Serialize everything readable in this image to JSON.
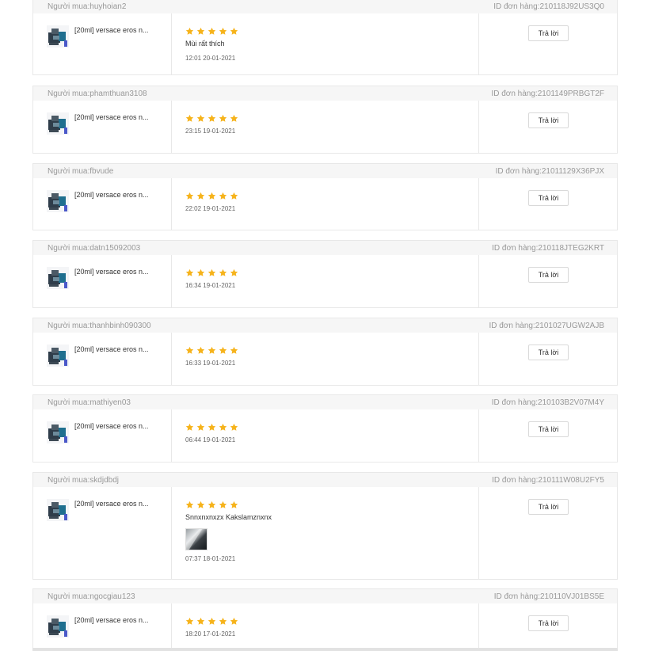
{
  "labels": {
    "buyer_prefix": "Người mua:",
    "order_prefix": "ID đơn hàng:",
    "reply_button": "Trả lời"
  },
  "colors": {
    "star": "#f6b31b",
    "border": "#e8e8e8",
    "header_bg": "#f6f6f6"
  },
  "reviews": [
    {
      "buyer": "huyhoian2",
      "order_id": "210118J92US3Q0",
      "product_name": "[20ml] versace eros n...",
      "stars": 5,
      "comment": "Mùi rất thích",
      "has_photo": false,
      "time": "12:01 20-01-2021"
    },
    {
      "buyer": "phamthuan3108",
      "order_id": "2101149PRBGT2F",
      "product_name": "[20ml] versace eros n...",
      "stars": 5,
      "comment": "",
      "has_photo": false,
      "time": "23:15 19-01-2021"
    },
    {
      "buyer": "fbvude",
      "order_id": "21011129X36PJX",
      "product_name": "[20ml] versace eros n...",
      "stars": 5,
      "comment": "",
      "has_photo": false,
      "time": "22:02 19-01-2021"
    },
    {
      "buyer": "datn15092003",
      "order_id": "210118JTEG2KRT",
      "product_name": "[20ml] versace eros n...",
      "stars": 5,
      "comment": "",
      "has_photo": false,
      "time": "16:34 19-01-2021"
    },
    {
      "buyer": "thanhbinh090300",
      "order_id": "2101027UGW2AJB",
      "product_name": "[20ml] versace eros n...",
      "stars": 5,
      "comment": "",
      "has_photo": false,
      "time": "16:33 19-01-2021"
    },
    {
      "buyer": "mathiyen03",
      "order_id": "210103B2V07M4Y",
      "product_name": "[20ml] versace eros n...",
      "stars": 5,
      "comment": "",
      "has_photo": false,
      "time": "06:44 19-01-2021"
    },
    {
      "buyer": "skdjdbdj",
      "order_id": "210111W08U2FY5",
      "product_name": "[20ml] versace eros n...",
      "stars": 5,
      "comment": "Snnxnxnxzx Kakslamznxnx",
      "has_photo": true,
      "time": "07:37 18-01-2021"
    },
    {
      "buyer": "ngocgiau123",
      "order_id": "210110VJ01BS5E",
      "product_name": "[20ml] versace eros n...",
      "stars": 5,
      "comment": "",
      "has_photo": false,
      "time": "18:20 17-01-2021"
    }
  ]
}
